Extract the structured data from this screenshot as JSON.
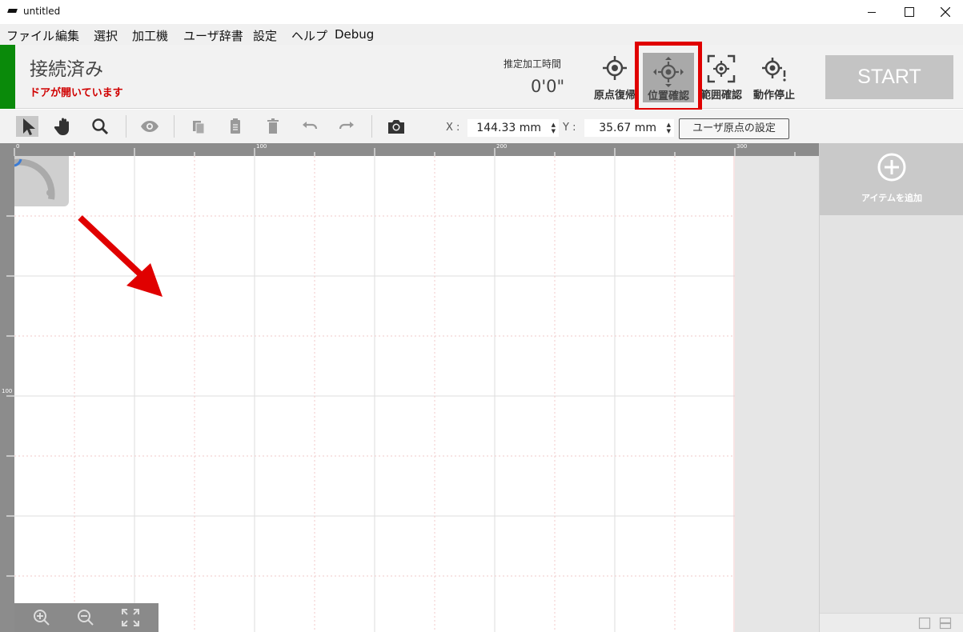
{
  "window": {
    "title": "untitled"
  },
  "menu": {
    "items": [
      "ファイル",
      "編集",
      "選択",
      "加工機",
      "ユーザ辞書",
      "設定",
      "ヘルプ",
      "Debug"
    ]
  },
  "status": {
    "connection": "接続済み",
    "door_message": "ドアが開いています",
    "estimate_label": "推定加工時間",
    "estimate_value": "0'0\""
  },
  "machine_buttons": {
    "home": "原点復帰",
    "position_check": "位置確認",
    "range_check": "範囲確認",
    "stop": "動作停止",
    "start": "START"
  },
  "toolbar": {
    "x_label": "X :",
    "x_value": "144.33 mm",
    "y_label": "Y :",
    "y_value": "35.67 mm",
    "set_origin": "ユーザ原点の設定"
  },
  "ruler": {
    "top_marks": [
      "0",
      "100",
      "200",
      "300"
    ],
    "left_marks": [
      "100"
    ]
  },
  "panel": {
    "add_item": "アイテムを追加"
  },
  "colors": {
    "connected": "#0a8a0a",
    "door_warning": "#d00000",
    "highlight": "#e00000",
    "arrow": "#e00000"
  }
}
